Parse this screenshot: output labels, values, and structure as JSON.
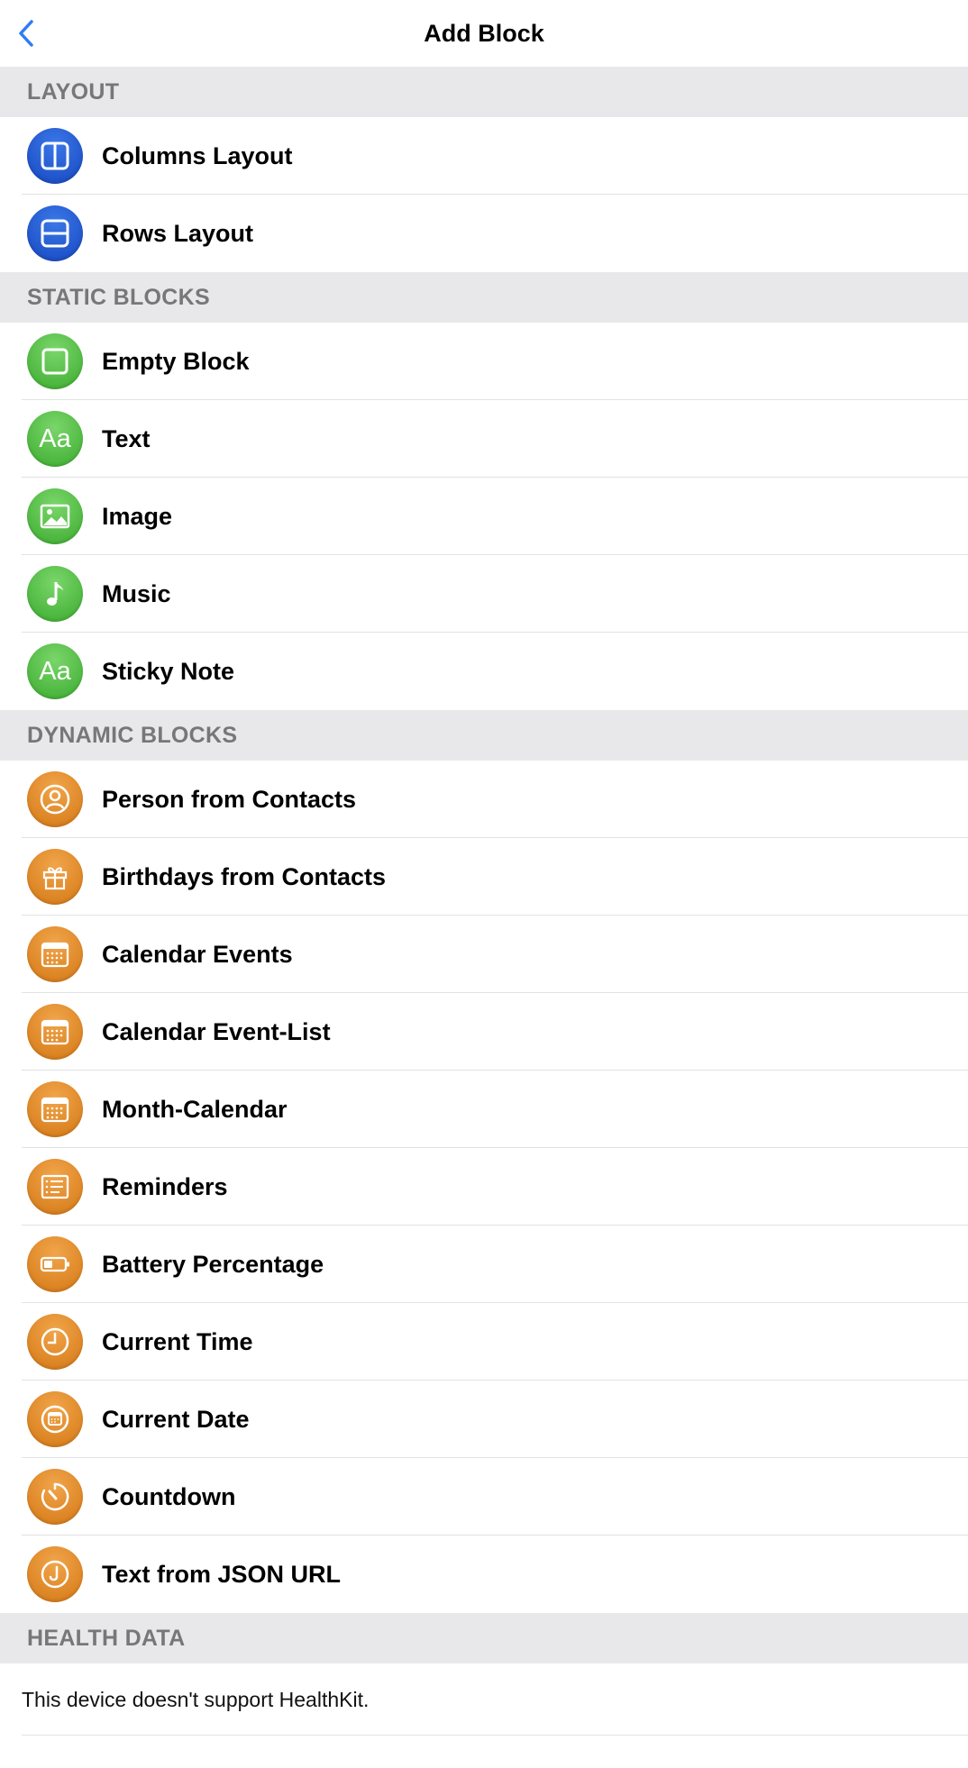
{
  "nav": {
    "title": "Add Block",
    "back_icon": "chevron-left-icon"
  },
  "colors": {
    "accent": "#2f7cf6",
    "layout_icon": "#2458d6",
    "static_icon": "#52bb42",
    "dynamic_icon": "#e18e2f",
    "section_bg": "#e8e8ea",
    "section_text": "#77777b"
  },
  "sections": {
    "layout": {
      "header": "LAYOUT",
      "items": [
        {
          "label": "Columns Layout",
          "icon": "columns-layout-icon"
        },
        {
          "label": "Rows Layout",
          "icon": "rows-layout-icon"
        }
      ]
    },
    "static_blocks": {
      "header": "STATIC BLOCKS",
      "items": [
        {
          "label": "Empty Block",
          "icon": "empty-square-icon"
        },
        {
          "label": "Text",
          "icon": "text-aa-icon",
          "icon_text": "Aa"
        },
        {
          "label": "Image",
          "icon": "photo-icon"
        },
        {
          "label": "Music",
          "icon": "music-note-icon"
        },
        {
          "label": "Sticky Note",
          "icon": "text-aa-icon",
          "icon_text": "Aa"
        }
      ]
    },
    "dynamic_blocks": {
      "header": "DYNAMIC BLOCKS",
      "items": [
        {
          "label": "Person from Contacts",
          "icon": "person-circle-icon"
        },
        {
          "label": "Birthdays from Contacts",
          "icon": "gift-icon"
        },
        {
          "label": "Calendar Events",
          "icon": "calendar-icon"
        },
        {
          "label": "Calendar Event-List",
          "icon": "calendar-icon"
        },
        {
          "label": "Month-Calendar",
          "icon": "calendar-icon"
        },
        {
          "label": "Reminders",
          "icon": "list-icon"
        },
        {
          "label": "Battery Percentage",
          "icon": "battery-icon"
        },
        {
          "label": "Current Time",
          "icon": "clock-icon"
        },
        {
          "label": "Current Date",
          "icon": "calendar-circle-icon"
        },
        {
          "label": "Countdown",
          "icon": "timer-icon"
        },
        {
          "label": "Text from JSON URL",
          "icon": "j-circle-icon"
        }
      ]
    },
    "health_data": {
      "header": "HEALTH DATA",
      "note": "This device doesn't support HealthKit."
    }
  }
}
